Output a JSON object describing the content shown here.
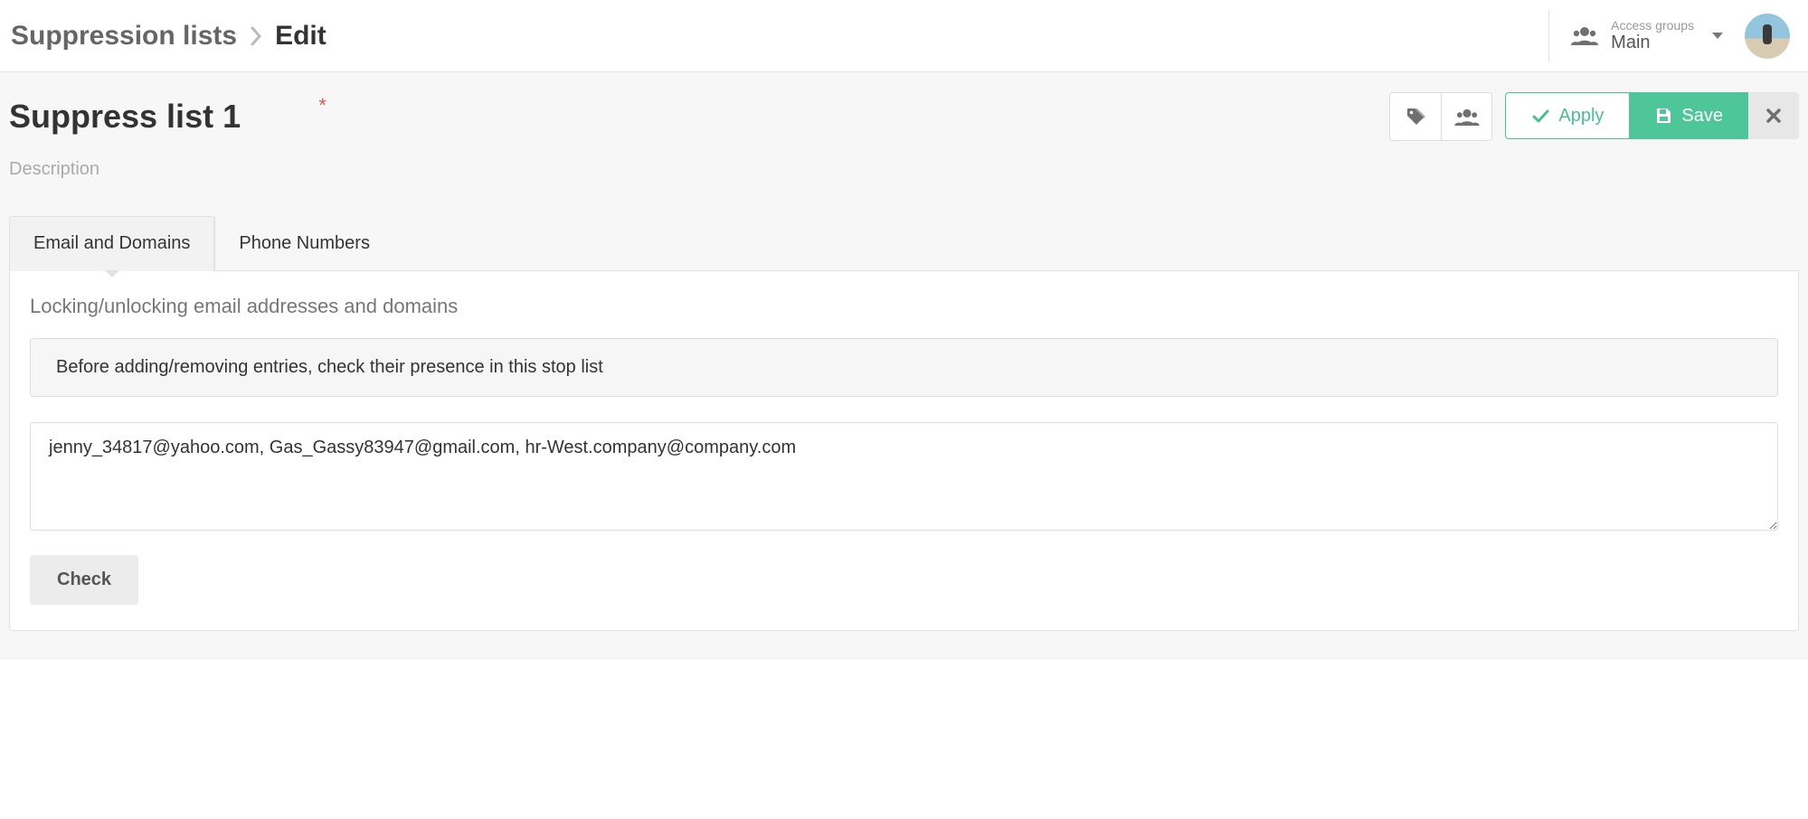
{
  "breadcrumb": {
    "root": "Suppression lists",
    "current": "Edit"
  },
  "access_groups": {
    "label": "Access groups",
    "value": "Main"
  },
  "page": {
    "title_value": "Suppress list 1",
    "description_placeholder": "Description"
  },
  "actions": {
    "apply": "Apply",
    "save": "Save"
  },
  "tabs": [
    {
      "label": "Email and Domains",
      "active": true
    },
    {
      "label": "Phone Numbers",
      "active": false
    }
  ],
  "panel": {
    "title": "Locking/unlocking email addresses and domains",
    "info": "Before adding/removing entries, check their presence in this stop list",
    "entries_value": "jenny_34817@yahoo.com, Gas_Gassy83947@gmail.com, hr-West.company@company.com",
    "check_label": "Check"
  }
}
